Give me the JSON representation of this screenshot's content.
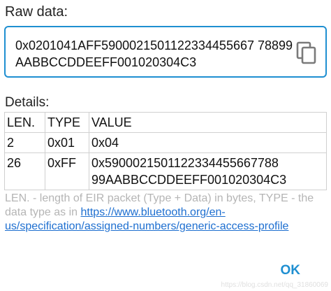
{
  "raw": {
    "label": "Raw data:",
    "value": "0x0201041AFF5900021501122334455667 78899AABBCCDDEEFF001020304C3"
  },
  "details": {
    "label": "Details:",
    "headers": [
      "LEN.",
      "TYPE",
      "VALUE"
    ],
    "rows": [
      {
        "len": "2",
        "type": "0x01",
        "value": "0x04"
      },
      {
        "len": "26",
        "type": "0xFF",
        "value": "0x5900021501122334455667788 99AABBCCDDEEFF001020304C3"
      }
    ]
  },
  "footer": {
    "text_before": "LEN. - length of EIR packet (Type + Data) in bytes, TYPE - the data type as in ",
    "link": "https://www.bluetooth.org/en-us/specification/assigned-numbers/generic-access-profile"
  },
  "actions": {
    "ok_label": "OK"
  },
  "watermark": "https://blog.csdn.net/qq_31860069",
  "icons": {
    "copy": "copy-icon"
  },
  "colors": {
    "accent": "#1f8fd1",
    "link": "#1e6fd0",
    "muted_text": "#b5b5b5"
  }
}
